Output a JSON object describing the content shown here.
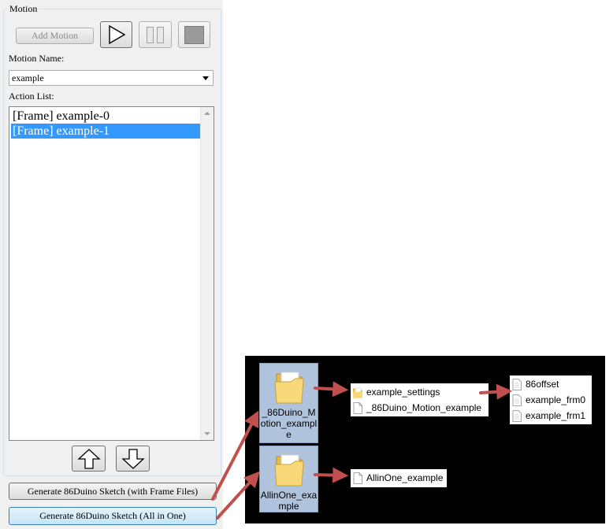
{
  "motion_group": {
    "title": "Motion",
    "add_motion_label": "Add Motion",
    "motion_name_label": "Motion Name:",
    "motion_name_value": "example",
    "action_list_label": "Action List:",
    "actions": [
      "[Frame] example-0",
      "[Frame] example-1"
    ],
    "selected_action_index": 1
  },
  "buttons": {
    "generate_frame_files": "Generate 86Duino Sketch (with Frame Files)",
    "generate_all_in_one": "Generate 86Duino Sketch (All in One)"
  },
  "explorer": {
    "folders": [
      {
        "label": "_86Duino_Motion_example"
      },
      {
        "label": "AllinOne_example"
      }
    ],
    "motion_folder_contents": [
      {
        "name": "example_settings",
        "type": "folder"
      },
      {
        "name": "_86Duino_Motion_example",
        "type": "file"
      }
    ],
    "settings_folder_contents": [
      "86offset",
      "example_frm0",
      "example_frm1"
    ],
    "allinone_folder_contents": [
      "AllinOne_example"
    ]
  },
  "colors": {
    "selection": "#3399ff",
    "arrow": "#c0504d",
    "explorer_bg": "#000000",
    "folder_tile": "#b0c3dc",
    "folder_yellow": "#f2cf6b"
  },
  "icons": [
    "play-icon",
    "pause-icon",
    "stop-icon",
    "arrow-up-icon",
    "arrow-down-icon",
    "folder-icon",
    "file-icon"
  ]
}
